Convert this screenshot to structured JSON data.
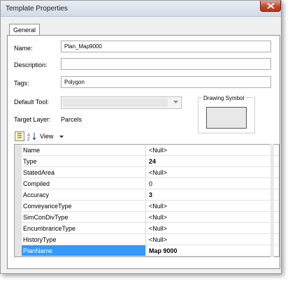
{
  "window": {
    "title": "Template Properties"
  },
  "tabs": [
    {
      "label": "General"
    }
  ],
  "form": {
    "name_label": "Name:",
    "name_value": "Plan_Map9000",
    "description_label": "Description:",
    "description_value": "",
    "tags_label": "Tags:",
    "tags_value": "Polygon",
    "default_tool_label": "Default Tool:",
    "default_tool_value": "",
    "target_layer_label": "Target Layer:",
    "target_layer_value": "Parcels",
    "drawing_symbol_label": "Drawing Symbol"
  },
  "toolbar": {
    "view_label": "View"
  },
  "properties": [
    {
      "name": "Name",
      "value": "<Null>",
      "bold": false
    },
    {
      "name": "Type",
      "value": "24",
      "bold": true
    },
    {
      "name": "StatedArea",
      "value": "<Null>",
      "bold": false
    },
    {
      "name": "Compiled",
      "value": "0",
      "bold": false
    },
    {
      "name": "Accuracy",
      "value": "3",
      "bold": true
    },
    {
      "name": "ConveyanceType",
      "value": "<Null>",
      "bold": false
    },
    {
      "name": "SimConDivType",
      "value": "<Null>",
      "bold": false
    },
    {
      "name": "EncumbranceType",
      "value": "<Null>",
      "bold": false
    },
    {
      "name": "HistoryType",
      "value": "<Null>",
      "bold": false
    },
    {
      "name": "PlanName",
      "value": "Map 9000",
      "bold": true,
      "selected": true
    }
  ],
  "colors": {
    "selection": "#3399ff",
    "close_button": "#c2452c"
  }
}
